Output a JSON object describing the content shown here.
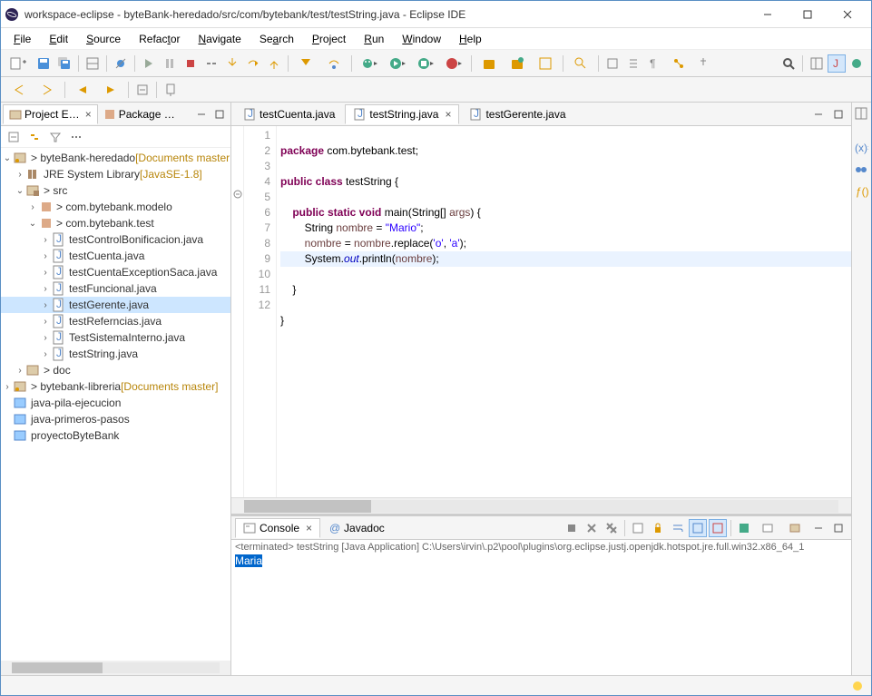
{
  "window": {
    "title": "workspace-eclipse - byteBank-heredado/src/com/bytebank/test/testString.java - Eclipse IDE"
  },
  "menus": [
    "File",
    "Edit",
    "Source",
    "Refactor",
    "Navigate",
    "Search",
    "Project",
    "Run",
    "Window",
    "Help"
  ],
  "left_panel": {
    "tabs": [
      {
        "label": "Project E…",
        "active": true,
        "close": true
      },
      {
        "label": "Package …",
        "active": false,
        "close": false
      }
    ]
  },
  "tree": {
    "p0": {
      "label": "byteBank-heredado",
      "deco": " [Documents master"
    },
    "p0a": {
      "label": "JRE System Library",
      "deco": " [JavaSE-1.8]"
    },
    "p0b": {
      "label": "src"
    },
    "p0b0": {
      "label": "com.bytebank.modelo"
    },
    "p0b1": {
      "label": "com.bytebank.test"
    },
    "f0": {
      "label": "testControlBonificacion.java"
    },
    "f1": {
      "label": "testCuenta.java"
    },
    "f2": {
      "label": "testCuentaExceptionSaca.java"
    },
    "f3": {
      "label": "testFuncional.java"
    },
    "f4": {
      "label": "testGerente.java"
    },
    "f5": {
      "label": "testReferncias.java"
    },
    "f6": {
      "label": "TestSistemaInterno.java"
    },
    "f7": {
      "label": "testString.java"
    },
    "p0c": {
      "label": "doc"
    },
    "p1": {
      "label": "bytebank-libreria",
      "deco": " [Documents master]"
    },
    "p2": {
      "label": "java-pila-ejecucion"
    },
    "p3": {
      "label": "java-primeros-pasos"
    },
    "p4": {
      "label": "proyectoByteBank"
    }
  },
  "editor_tabs": [
    {
      "label": "testCuenta.java",
      "active": false
    },
    {
      "label": "testString.java",
      "active": true
    },
    {
      "label": "testGerente.java",
      "active": false
    }
  ],
  "code_lines": {
    "l1a": "package",
    "l1b": " com.bytebank.test;",
    "l3a": "public class",
    "l3b": " testString {",
    "l5a": "    public static void",
    "l5b": " main(String[] ",
    "l5c": "args",
    "l5d": ") {",
    "l6a": "        String ",
    "l6b": "nombre",
    "l6c": " = ",
    "l6d": "\"Mario\"",
    "l6e": ";",
    "l7a": "        ",
    "l7b": "nombre",
    "l7c": " = ",
    "l7d": "nombre",
    "l7e": ".replace(",
    "l7f": "'o'",
    "l7g": ", ",
    "l7h": "'a'",
    "l7i": ");",
    "l8a": "        System.",
    "l8b": "out",
    "l8c": ".println(",
    "l8d": "nombre",
    "l8e": ");",
    "l9": "    }",
    "l11": "}"
  },
  "line_numbers": [
    "1",
    "2",
    "3",
    "4",
    "5",
    "6",
    "7",
    "8",
    "9",
    "10",
    "11",
    "12"
  ],
  "console": {
    "tabs": [
      {
        "label": "Console",
        "active": true
      },
      {
        "label": "Javadoc",
        "active": false
      }
    ],
    "status": "<terminated> testString [Java Application] C:\\Users\\irvin\\.p2\\pool\\plugins\\org.eclipse.justj.openjdk.hotspot.jre.full.win32.x86_64_1",
    "output": "Maria"
  }
}
